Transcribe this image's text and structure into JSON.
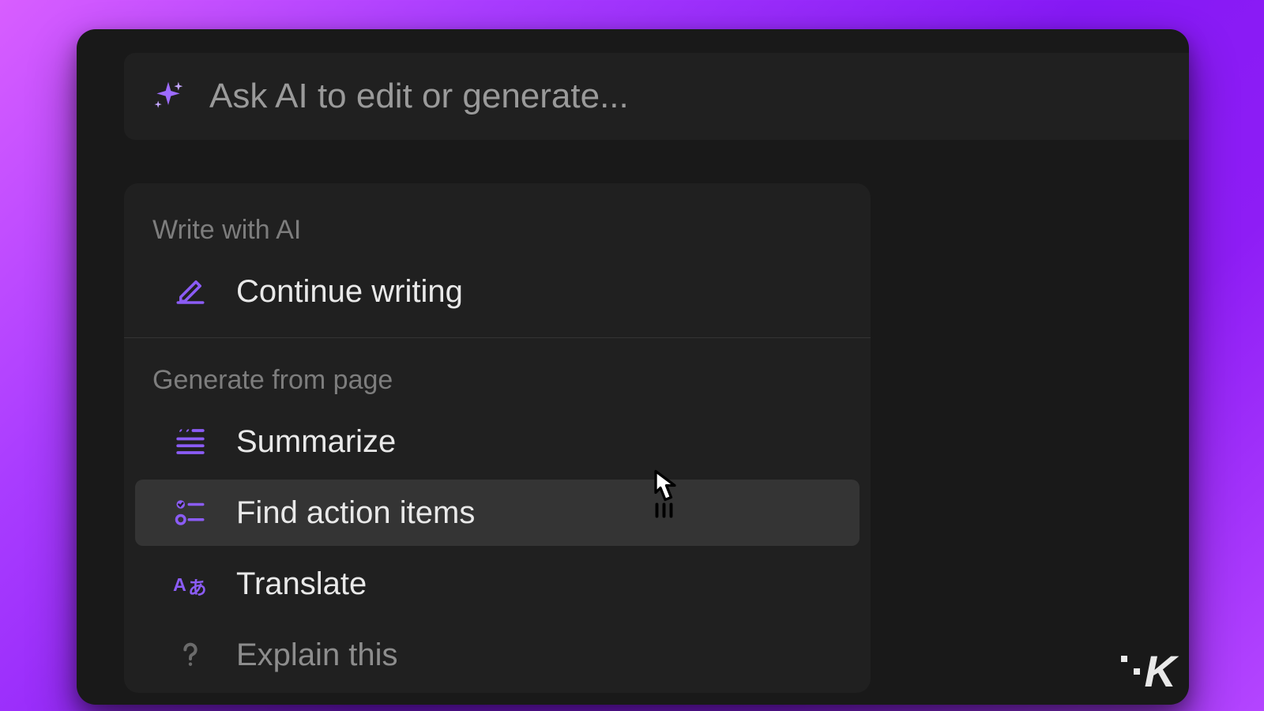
{
  "colors": {
    "accent": "#8b5cf6",
    "panel": "#191919",
    "menu_bg": "#202020",
    "hover": "#343434",
    "text": "#e9e9e9",
    "muted": "#7d7d7d"
  },
  "ask_bar": {
    "placeholder": "Ask AI to edit or generate...",
    "icon": "sparkle-icon"
  },
  "sections": [
    {
      "title": "Write with AI",
      "items": [
        {
          "icon": "pencil-line-icon",
          "label": "Continue writing",
          "hover": false
        }
      ]
    },
    {
      "title": "Generate from page",
      "items": [
        {
          "icon": "summarize-icon",
          "label": "Summarize",
          "hover": false
        },
        {
          "icon": "action-items-icon",
          "label": "Find action items",
          "hover": true
        },
        {
          "icon": "translate-icon",
          "label": "Translate",
          "hover": false
        },
        {
          "icon": "question-icon",
          "label": "Explain this",
          "hover": false,
          "faded": true
        }
      ]
    }
  ],
  "watermark": {
    "text": "K"
  }
}
